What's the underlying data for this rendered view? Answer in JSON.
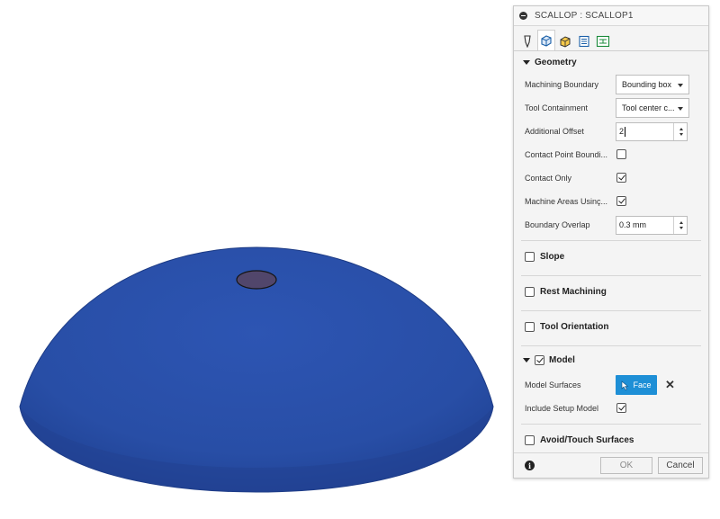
{
  "dialog": {
    "title": "SCALLOP : SCALLOP1",
    "tabs": [
      {
        "icon": "tool-icon",
        "active": false
      },
      {
        "icon": "geometry-icon",
        "active": true
      },
      {
        "icon": "heights-icon",
        "active": false
      },
      {
        "icon": "passes-icon",
        "active": false
      },
      {
        "icon": "linking-icon",
        "active": false
      }
    ]
  },
  "geometry": {
    "title": "Geometry",
    "machining_boundary": {
      "label": "Machining Boundary",
      "value": "Bounding box"
    },
    "tool_containment": {
      "label": "Tool Containment",
      "value": "Tool center c..."
    },
    "additional_offset": {
      "label": "Additional Offset",
      "value": "2"
    },
    "contact_point_boundary": {
      "label": "Contact Point Boundi...",
      "checked": false
    },
    "contact_only": {
      "label": "Contact Only",
      "checked": true
    },
    "machine_areas": {
      "label": "Machine Areas Usinç...",
      "checked": true
    },
    "boundary_overlap": {
      "label": "Boundary Overlap",
      "value": "0.3 mm"
    }
  },
  "sections": {
    "slope": "Slope",
    "rest_machining": "Rest Machining",
    "tool_orientation": "Tool Orientation",
    "avoid_touch": "Avoid/Touch Surfaces"
  },
  "model": {
    "title": "Model",
    "checked": true,
    "surfaces_label": "Model Surfaces",
    "face_button": "Face",
    "include_setup_label": "Include Setup Model",
    "include_setup_checked": true
  },
  "footer": {
    "ok": "OK",
    "cancel": "Cancel"
  },
  "colors": {
    "model_blue": "#2a4fa8",
    "accent_blue": "#1e8fd6"
  }
}
